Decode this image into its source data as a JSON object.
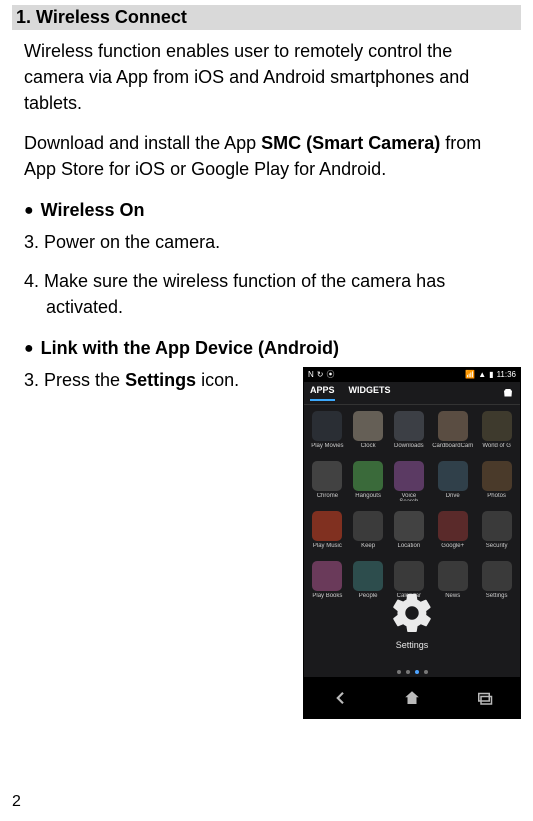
{
  "heading": "1.   Wireless Connect",
  "intro1": "Wireless function enables user to remotely control the camera via App from iOS and Android smartphones and tablets.",
  "intro2_a": "Download and install the App ",
  "intro2_bold": "SMC (Smart Camera)",
  "intro2_b": " from App Store for iOS or Google Play for Android.",
  "sub1": "Wireless On",
  "step3": "3. Power on the camera.",
  "step4": "4. Make sure the wireless function of the camera has activated.",
  "sub2": "Link with the App Device (Android)",
  "step3b_a": "3. Press the ",
  "step3b_bold": "Settings",
  "step3b_b": " icon.",
  "page_number": "2",
  "phone": {
    "time": "11:36",
    "tab_apps": "APPS",
    "tab_widgets": "WIDGETS",
    "settings_label": "Settings",
    "app_icons": [
      {
        "bg": "#2a2e34",
        "lbl": "Play Movies"
      },
      {
        "bg": "#655f56",
        "lbl": "Clock"
      },
      {
        "bg": "#3c3f45",
        "lbl": "Downloads"
      },
      {
        "bg": "#5a4d42",
        "lbl": "CardboardCam"
      },
      {
        "bg": "#3e3a2d",
        "lbl": "World of G"
      },
      {
        "bg": "#424242",
        "lbl": "Chrome"
      },
      {
        "bg": "#3a6a3a",
        "lbl": "Hangouts"
      },
      {
        "bg": "#5b3a63",
        "lbl": "Voice Search"
      },
      {
        "bg": "#30404a",
        "lbl": "Drive"
      },
      {
        "bg": "#4a3a2a",
        "lbl": "Photos"
      },
      {
        "bg": "#803020",
        "lbl": "Play Music"
      },
      {
        "bg": "#3b3b3b",
        "lbl": "Keep"
      },
      {
        "bg": "#424242",
        "lbl": "Location"
      },
      {
        "bg": "#5a2a2a",
        "lbl": "Google+"
      },
      {
        "bg": "#3a3a3a",
        "lbl": "Security"
      },
      {
        "bg": "#6a3a5a",
        "lbl": "Play Books"
      },
      {
        "bg": "#2d4d4d",
        "lbl": "People"
      },
      {
        "bg": "#3a3a3a",
        "lbl": "Calendar"
      },
      {
        "bg": "#3a3a3a",
        "lbl": "News"
      },
      {
        "bg": "#3a3a3a",
        "lbl": "Settings"
      }
    ]
  }
}
